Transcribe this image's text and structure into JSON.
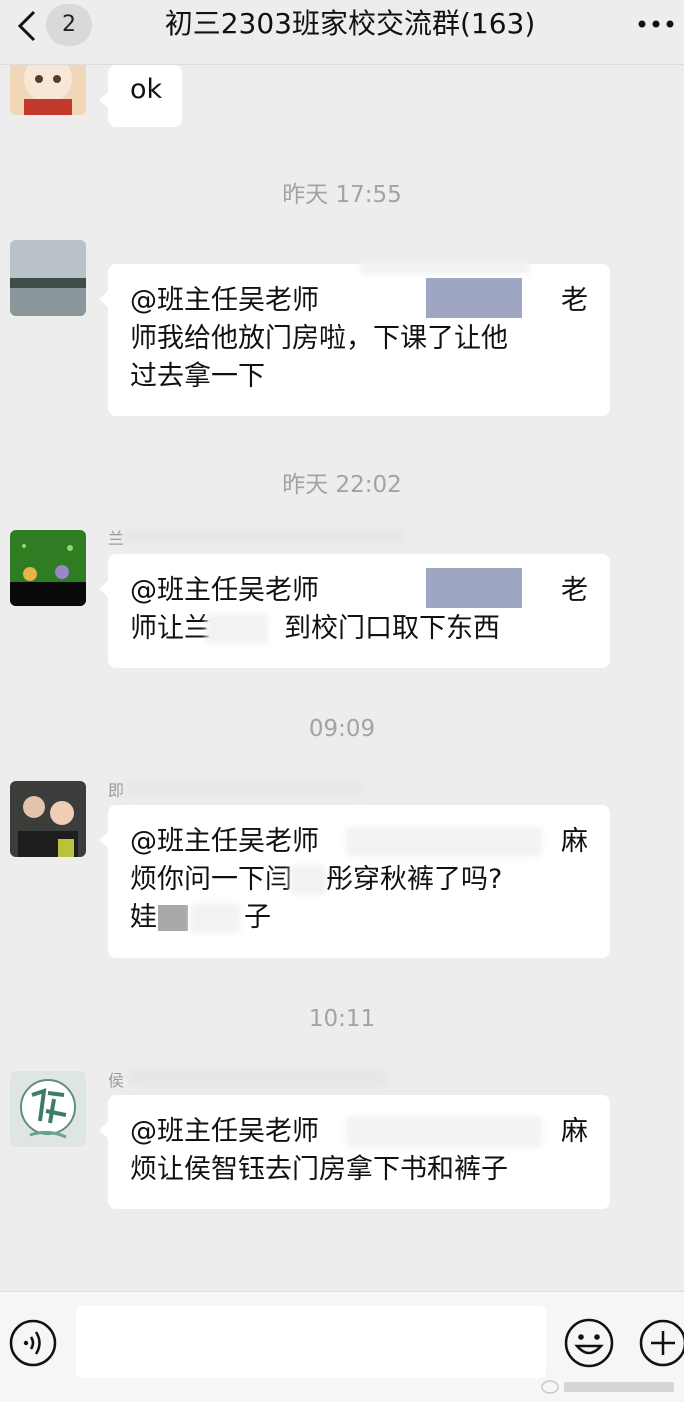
{
  "header": {
    "back_icon": "chevron-left-icon",
    "unread_count": "2",
    "title": "初三2303班家校交流群(163)",
    "more_icon": "more-dots-icon"
  },
  "messages": [
    {
      "type": "text",
      "sender_avatar": "cartoon-cat-avatar",
      "lines": [
        "ok"
      ]
    },
    {
      "type": "time",
      "text": "昨天 17:55"
    },
    {
      "type": "text",
      "sender_avatar": "lake-scenery-avatar",
      "lines": [
        "@班主任吴老师",
        "老",
        "师我给他放门房啦，下课了让他",
        "过去拿一下"
      ]
    },
    {
      "type": "time",
      "text": "昨天 22:02"
    },
    {
      "type": "text",
      "sender_name": "兰",
      "sender_avatar": "green-snail-avatar",
      "lines": [
        "@班主任吴老师",
        "老",
        "师让兰",
        "到校门口取下东西"
      ]
    },
    {
      "type": "time",
      "text": "09:09"
    },
    {
      "type": "text",
      "sender_name": "即",
      "sender_avatar": "selfie-photo-avatar",
      "lines": [
        "@班主任吴老师",
        "麻",
        "烦你问一下闫",
        "彤穿秋裤了吗?",
        "娃",
        "子"
      ]
    },
    {
      "type": "time",
      "text": "10:11"
    },
    {
      "type": "text",
      "sender_name": "侯",
      "sender_avatar": "hou-calligraphy-avatar",
      "lines": [
        "@班主任吴老师",
        "麻",
        "烦让侯智钰去门房拿下书和裤子"
      ]
    }
  ],
  "input_bar": {
    "voice_icon": "voice-input-icon",
    "text_value": "",
    "emoji_icon": "emoji-icon",
    "plus_icon": "plus-circle-icon"
  },
  "colors": {
    "background": "#ededed",
    "bubble": "#ffffff",
    "time_text": "#a3a3a3",
    "mosaic": "#8e97b6"
  }
}
